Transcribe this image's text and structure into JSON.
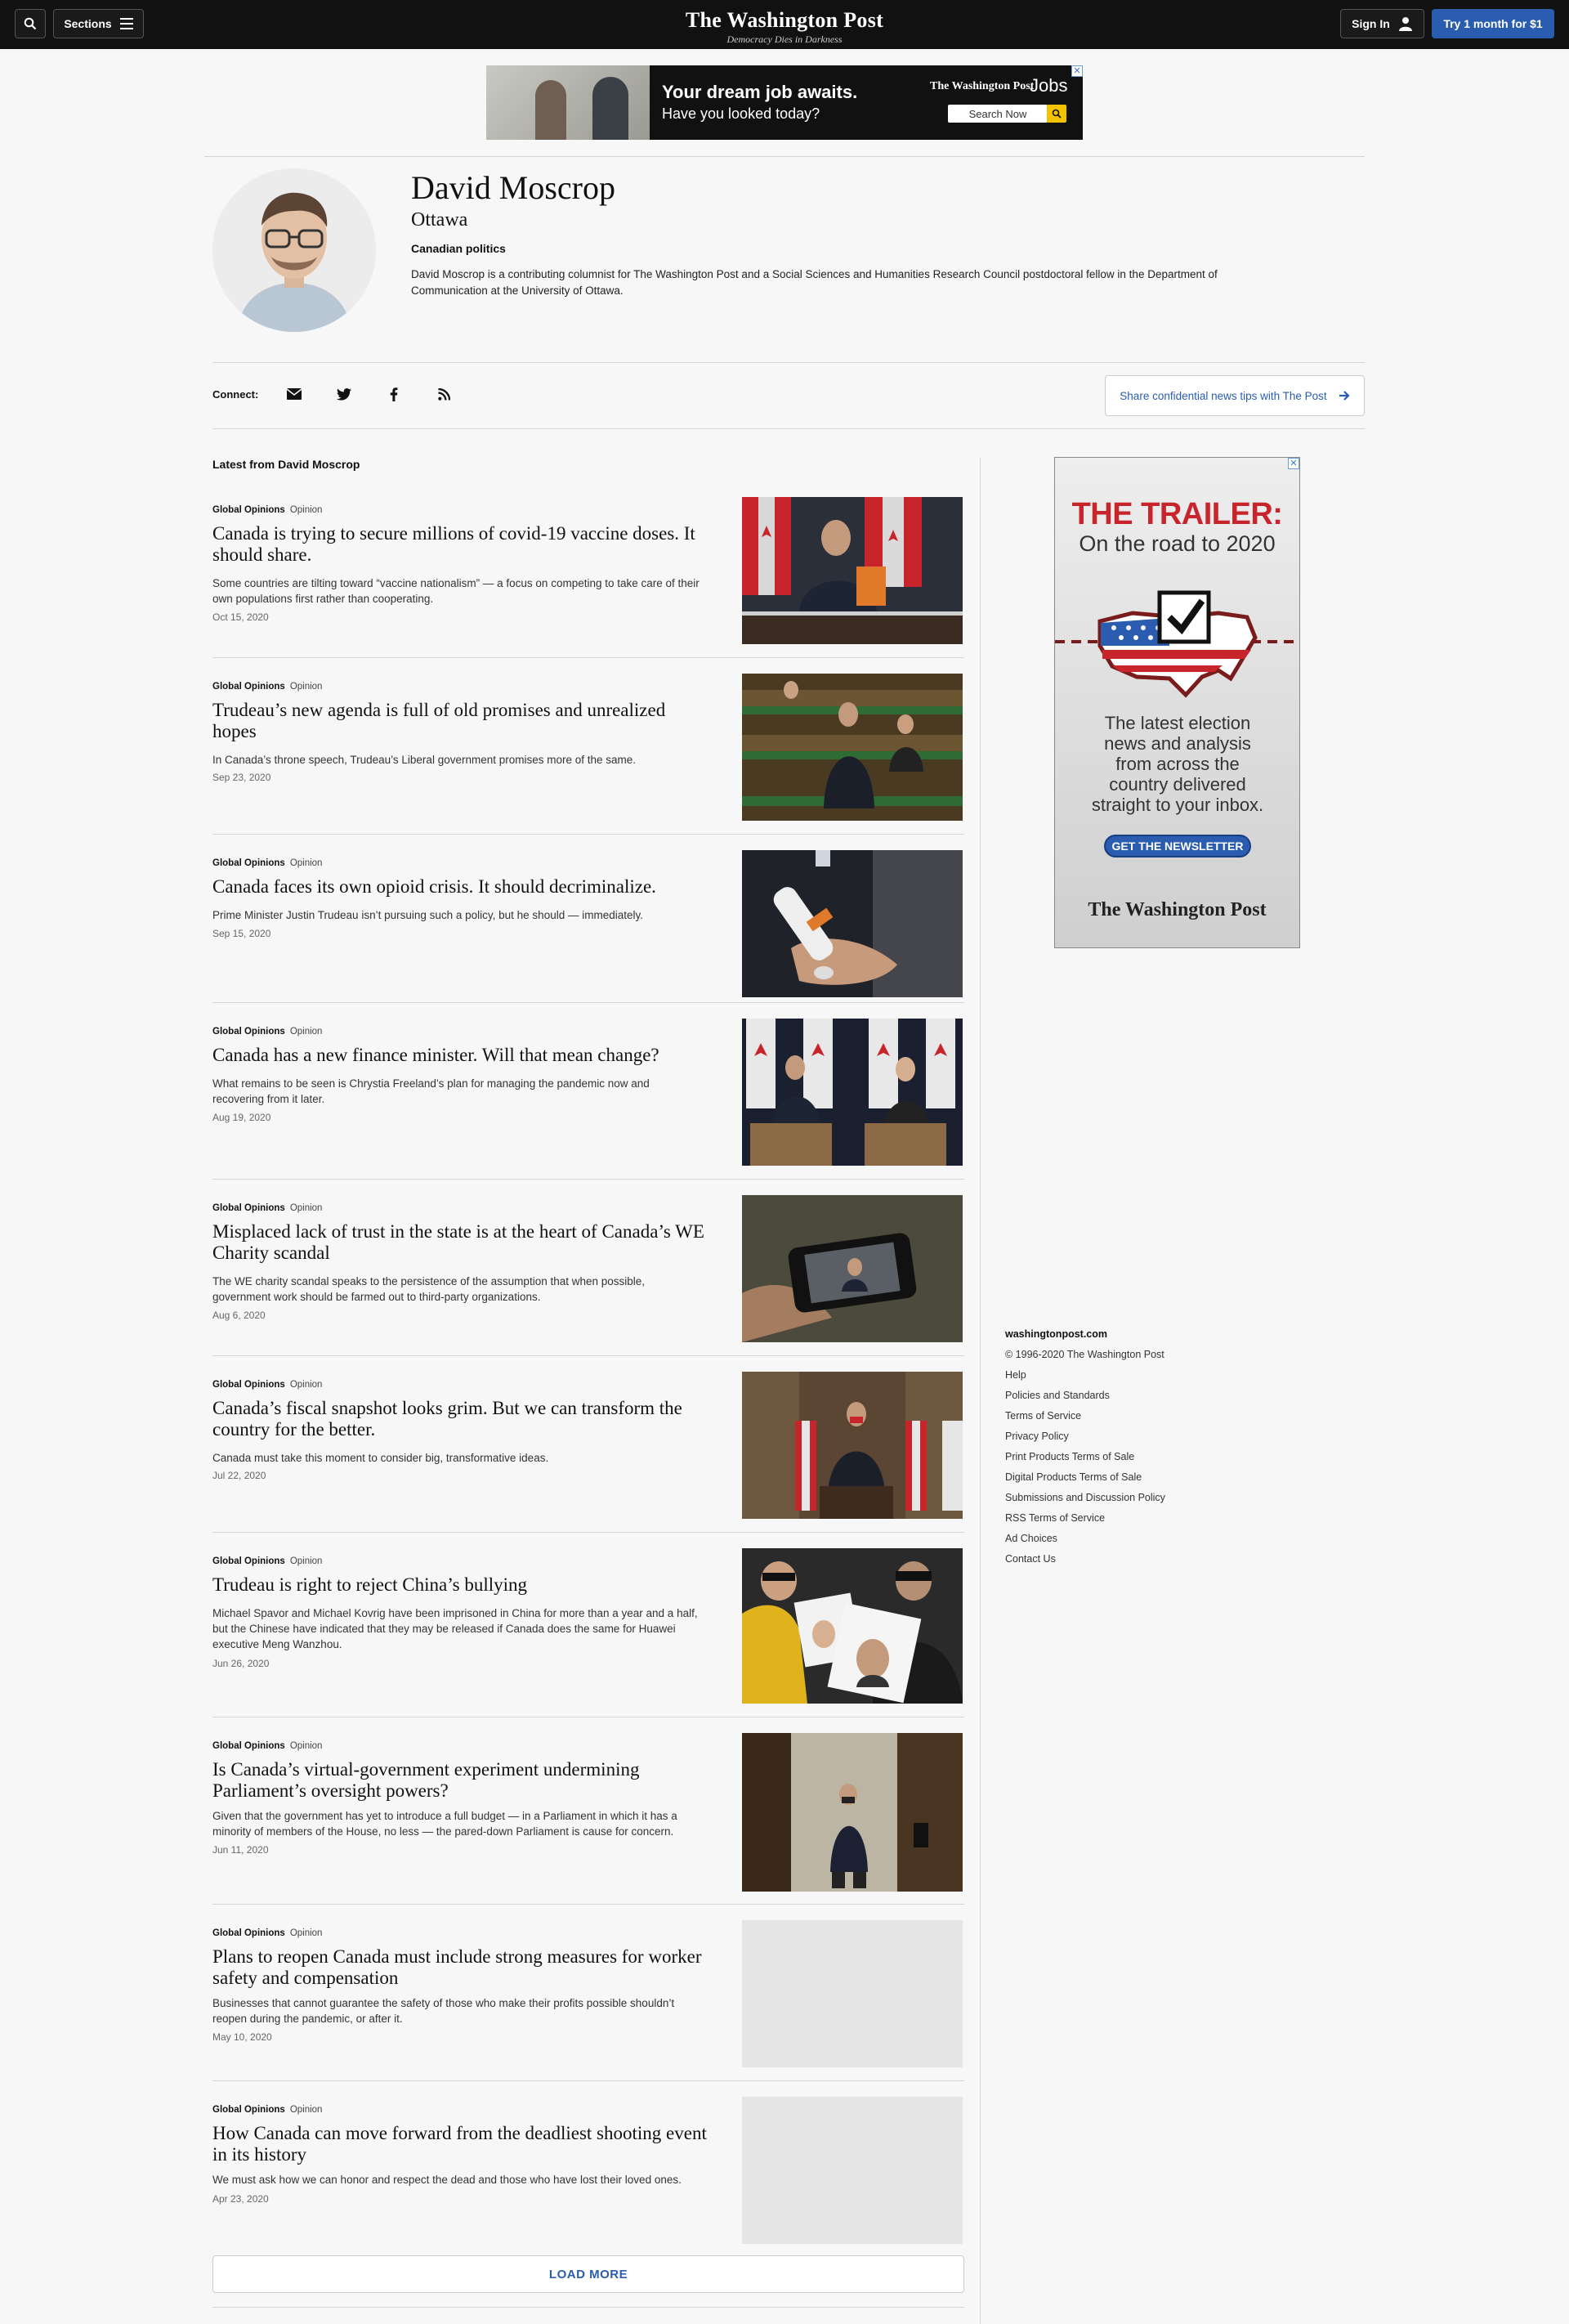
{
  "header": {
    "sections_label": "Sections",
    "logo": "The Washington Post",
    "tagline": "Democracy Dies in Darkness",
    "sign_in_label": "Sign In",
    "subscribe_label": "Try 1 month for $1"
  },
  "top_ad": {
    "headline": "Your dream job awaits.",
    "subline": "Have you looked today?",
    "brand": "The Washington Post",
    "product": "Jobs",
    "search_label": "Search Now"
  },
  "author": {
    "name": "David Moscrop",
    "location": "Ottawa",
    "beat": "Canadian politics",
    "bio": "David Moscrop is a contributing columnist for The Washington Post and a Social Sciences and Humanities Research Council postdoctoral fellow in the Department of Communication at the University of Ottawa."
  },
  "connect": {
    "label": "Connect:",
    "icons": [
      "email-icon",
      "twitter-icon",
      "facebook-icon",
      "rss-icon"
    ],
    "tips_label": "Share confidential news tips with The Post"
  },
  "section_title": "Latest from David Moscrop",
  "articles": [
    {
      "section": "Global Opinions",
      "type": "Opinion",
      "headline": "Canada is trying to secure millions of covid-19 vaccine doses. It should share.",
      "blurb": "Some countries are tilting toward “vaccine nationalism” — a focus on competing to take care of their own populations first rather than cooperating.",
      "date": "Oct 15, 2020"
    },
    {
      "section": "Global Opinions",
      "type": "Opinion",
      "headline": "Trudeau’s new agenda is full of old promises and unrealized hopes",
      "blurb": "In Canada’s throne speech, Trudeau’s Liberal government promises more of the same.",
      "date": "Sep 23, 2020"
    },
    {
      "section": "Global Opinions",
      "type": "Opinion",
      "headline": "Canada faces its own opioid crisis. It should decriminalize.",
      "blurb": "Prime Minister Justin Trudeau isn’t pursuing such a policy, but he should — immediately.",
      "date": "Sep 15, 2020"
    },
    {
      "section": "Global Opinions",
      "type": "Opinion",
      "headline": "Canada has a new finance minister. Will that mean change?",
      "blurb": "What remains to be seen is Chrystia Freeland’s plan for managing the pandemic now and recovering from it later.",
      "date": "Aug 19, 2020"
    },
    {
      "section": "Global Opinions",
      "type": "Opinion",
      "headline": "Misplaced lack of trust in the state is at the heart of Canada’s WE Charity scandal",
      "blurb": "The WE charity scandal speaks to the persistence of the assumption that when possible, government work should be farmed out to third-party organizations.",
      "date": "Aug 6, 2020"
    },
    {
      "section": "Global Opinions",
      "type": "Opinion",
      "headline": "Canada’s fiscal snapshot looks grim. But we can transform the country for the better.",
      "blurb": "Canada must take this moment to consider big, transformative ideas.",
      "date": "Jul 22, 2020"
    },
    {
      "section": "Global Opinions",
      "type": "Opinion",
      "headline": "Trudeau is right to reject China’s bullying",
      "blurb": "Michael Spavor and Michael Kovrig have been imprisoned in China for more than a year and a half, but the Chinese have indicated that they may be released if Canada does the same for Huawei executive Meng Wanzhou.",
      "date": "Jun 26, 2020"
    },
    {
      "section": "Global Opinions",
      "type": "Opinion",
      "headline": "Is Canada’s virtual-government experiment undermining Parliament’s oversight powers?",
      "blurb": "Given that the government has yet to introduce a full budget — in a Parliament in which it has a minority of members of the House, no less — the pared-down Parliament is cause for concern.",
      "date": "Jun 11, 2020"
    },
    {
      "section": "Global Opinions",
      "type": "Opinion",
      "headline": "Plans to reopen Canada must include strong measures for worker safety and compensation",
      "blurb": "Businesses that cannot guarantee the safety of those who make their profits possible shouldn’t reopen during the pandemic, or after it.",
      "date": "May 10, 2020"
    },
    {
      "section": "Global Opinions",
      "type": "Opinion",
      "headline": "How Canada can move forward from the deadliest shooting event in its history",
      "blurb": "We must ask how we can honor and respect the dead and those who have lost their loved ones.",
      "date": "Apr 23, 2020"
    }
  ],
  "load_more_label": "LOAD MORE",
  "side_ad": {
    "title": "THE TRAILER:",
    "subtitle": "On the road to 2020",
    "body": "The latest election news and analysis from across the country delivered straight to your inbox.",
    "cta": "GET THE NEWSLETTER",
    "brand": "The Washington Post"
  },
  "footer": {
    "site": "washingtonpost.com",
    "links": [
      "© 1996-2020 The Washington Post",
      "Help",
      "Policies and Standards",
      "Terms of Service",
      "Privacy Policy",
      "Print Products Terms of Sale",
      "Digital Products Terms of Sale",
      "Submissions and Discussion Policy",
      "RSS Terms of Service",
      "Ad Choices",
      "Contact Us"
    ]
  },
  "colors": {
    "nav_bg": "#111111",
    "accent_blue": "#2a5db0",
    "trailer_red": "#c8242b",
    "page_bg": "#f7f7f7"
  }
}
